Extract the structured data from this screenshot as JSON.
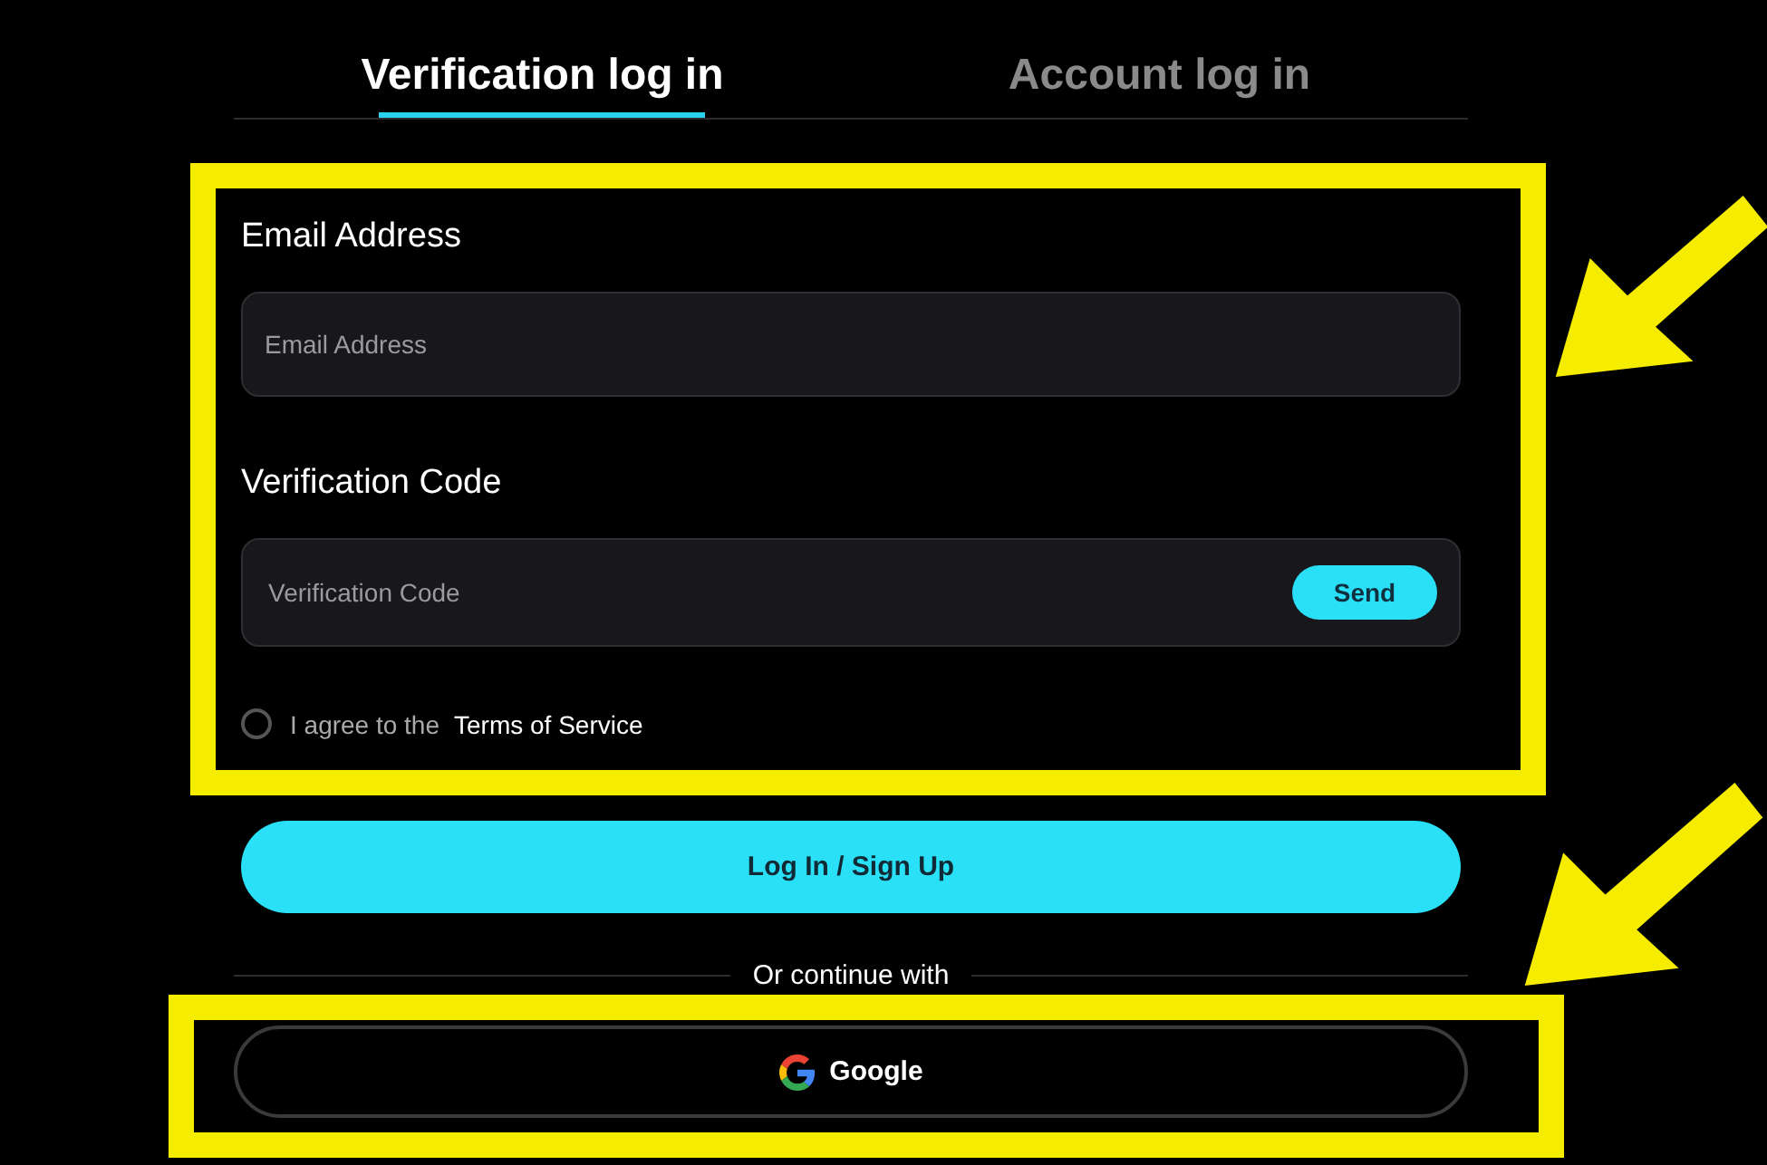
{
  "tabs": [
    {
      "label": "Verification log in",
      "selected": true
    },
    {
      "label": "Account log in",
      "selected": false
    }
  ],
  "form": {
    "email_label": "Email Address",
    "email": {
      "placeholder": "Email Address"
    },
    "code_label": "Verification Code",
    "code": {
      "placeholder": "Verification Code"
    },
    "send_button": "Send",
    "agree": {
      "checked": false,
      "text": "I agree to the",
      "link": "Terms of Service"
    }
  },
  "submit_button": "Log In / Sign Up",
  "divider_text": "Or continue with",
  "google_button": "Google"
}
